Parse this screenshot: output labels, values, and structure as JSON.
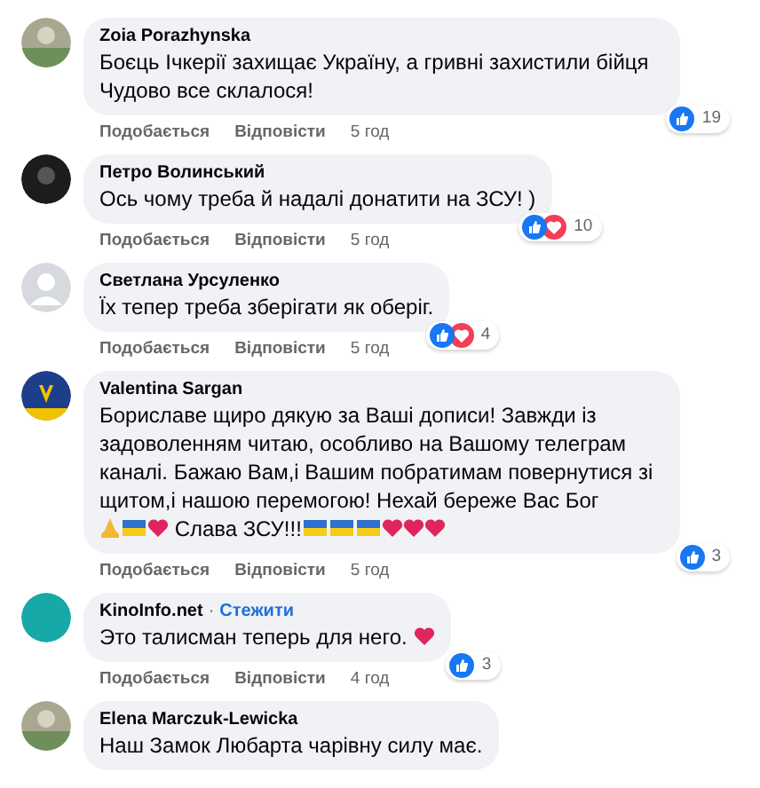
{
  "comments": [
    {
      "author": "Zoia Porazhynska",
      "avatar": {
        "kind": "photo"
      },
      "parts": [
        {
          "kind": "text",
          "text": "Боєць Ічкерії захищає Україну, а гривні захистили бійця Чудово все склалося!"
        }
      ],
      "reactions": [
        {
          "kind": "like"
        }
      ],
      "reaction_count": "19",
      "actions": [
        "Подобається",
        "Відповісти"
      ],
      "time": "5 год"
    },
    {
      "author": "Петро Волинський",
      "avatar": {
        "kind": "dark"
      },
      "parts": [
        {
          "kind": "text",
          "text": "Ось чому треба й надалі донатити на ЗСУ! )"
        }
      ],
      "reactions": [
        {
          "kind": "like"
        },
        {
          "kind": "love"
        }
      ],
      "reaction_count": "10",
      "actions": [
        "Подобається",
        "Відповісти"
      ],
      "time": "5 год"
    },
    {
      "author": "Светлана Урсуленко",
      "avatar": {
        "kind": "default"
      },
      "parts": [
        {
          "kind": "text",
          "text": "Їх тепер треба зберігати як оберіг."
        }
      ],
      "reactions": [
        {
          "kind": "like"
        },
        {
          "kind": "love"
        }
      ],
      "reaction_count": "4",
      "actions": [
        "Подобається",
        "Відповісти"
      ],
      "time": "5 год"
    },
    {
      "author": "Valentina Sargan",
      "avatar": {
        "kind": "emblem"
      },
      "parts": [
        {
          "kind": "text",
          "text": "Бориславе щиро дякую за Ваші дописи! Завжди із задоволенням читаю, особливо на Вашому телеграм каналі. Бажаю Вам,і Вашим побратимам повернутися зі щитом,і нашою перемогою! Нехай береже Вас Бог"
        },
        {
          "kind": "break"
        },
        {
          "kind": "pray"
        },
        {
          "kind": "flag"
        },
        {
          "kind": "heart"
        },
        {
          "kind": "text",
          "text": " Слава ЗСУ!!!"
        },
        {
          "kind": "flag"
        },
        {
          "kind": "flag"
        },
        {
          "kind": "flag"
        },
        {
          "kind": "heart"
        },
        {
          "kind": "heart"
        },
        {
          "kind": "heart"
        }
      ],
      "reactions": [
        {
          "kind": "like"
        }
      ],
      "reaction_count": "3",
      "actions": [
        "Подобається",
        "Відповісти"
      ],
      "time": "5 год"
    },
    {
      "author": "KinoInfo.net",
      "separator": "·",
      "follow": "Стежити",
      "avatar": {
        "kind": "teal"
      },
      "parts": [
        {
          "kind": "text",
          "text": "Это талисман теперь для него. "
        },
        {
          "kind": "heart"
        }
      ],
      "reactions": [
        {
          "kind": "like"
        }
      ],
      "reaction_count": "3",
      "actions": [
        "Подобається",
        "Відповісти"
      ],
      "time": "4 год"
    },
    {
      "author": "Elena Marczuk-Lewicka",
      "avatar": {
        "kind": "photo"
      },
      "parts": [
        {
          "kind": "text",
          "text": "Наш Замок Любарта чарівну силу має."
        }
      ]
    }
  ]
}
